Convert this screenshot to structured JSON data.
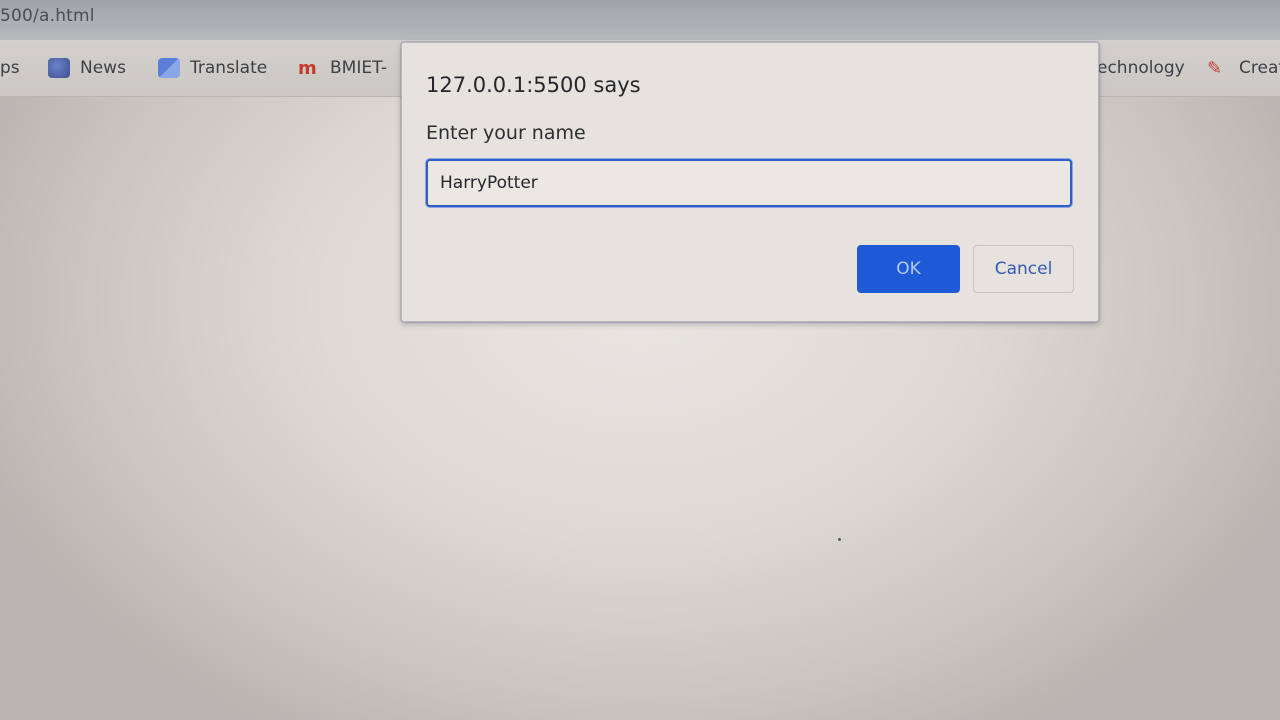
{
  "address": {
    "url_fragment": "500/a.html"
  },
  "bookmarks": [
    {
      "label": "ps",
      "icon": "apps-icon"
    },
    {
      "label": "News",
      "icon": "news-icon"
    },
    {
      "label": "Translate",
      "icon": "translate-icon"
    },
    {
      "label": "BMIET-",
      "icon": "bmiet-icon"
    },
    {
      "label": "echnology",
      "icon": ""
    },
    {
      "label": "Creat",
      "icon": "create-icon"
    }
  ],
  "dialog": {
    "title": "127.0.0.1:5500 says",
    "message": "Enter your name",
    "input_value": "HarryPotter",
    "ok_label": "OK",
    "cancel_label": "Cancel"
  },
  "colors": {
    "accent": "#1f5ad6",
    "input_border": "#2f5ec9",
    "cancel_text": "#3659b3"
  }
}
